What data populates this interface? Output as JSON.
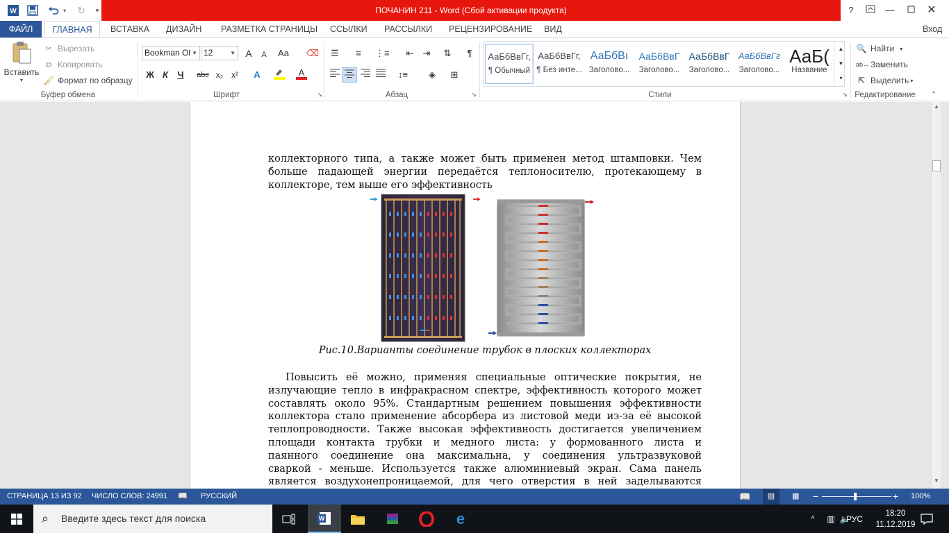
{
  "window": {
    "title": "ПОЧАНИН 211 -  Word (Сбой активации продукта)",
    "help": "?",
    "signin": "Вход"
  },
  "tabs": [
    "ФАЙЛ",
    "ГЛАВНАЯ",
    "ВСТАВКА",
    "ДИЗАЙН",
    "РАЗМЕТКА СТРАНИЦЫ",
    "ССЫЛКИ",
    "РАССЫЛКИ",
    "РЕЦЕНЗИРОВАНИЕ",
    "ВИД"
  ],
  "active_tab": "ГЛАВНАЯ",
  "ribbon": {
    "clipboard": {
      "label": "Буфер обмена",
      "paste": "Вставить",
      "cut": "Вырезать",
      "copy": "Копировать",
      "format_painter": "Формат по образцу"
    },
    "font": {
      "label": "Шрифт",
      "font_name": "Bookman Ol",
      "font_size": "12",
      "bold": "Ж",
      "italic": "К",
      "underline": "Ч",
      "strikethrough": "abc",
      "subscript": "x₂",
      "superscript": "x²",
      "grow": "A",
      "shrink": "A",
      "case": "Aa"
    },
    "paragraph": {
      "label": "Абзац"
    },
    "styles": {
      "label": "Стили",
      "items": [
        {
          "sample": "АаБбВвГг,",
          "name": "¶ Обычный"
        },
        {
          "sample": "АаБбВвГг,",
          "name": "¶ Без инте..."
        },
        {
          "sample": "АаБбВı",
          "name": "Заголово..."
        },
        {
          "sample": "АаБбВвГ",
          "name": "Заголово..."
        },
        {
          "sample": "АаБбВвГ",
          "name": "Заголово..."
        },
        {
          "sample": "АаБбВвГг",
          "name": "Заголово..."
        },
        {
          "sample": "АаБ(",
          "name": "Название"
        }
      ]
    },
    "editing": {
      "label": "Редактирование",
      "find": "Найти",
      "replace": "Заменить",
      "select": "Выделить"
    }
  },
  "document": {
    "para1_lines": [
      "коллекторного типа, а также может быть применен метод штамповки. Чем",
      "больше падающей энергии передаётся теплоносителю, протекающему в",
      "коллекторе, тем выше его эффективность"
    ],
    "caption": "Рис.10.Варианты соединение трубок в плоских коллекторах",
    "para2_lines": [
      "Повысить её можно, применяя специальные оптические покрытия, не",
      "излучающие тепло в инфракрасном спектре, эффективность которого может",
      "составлять около 95%. Стандартным решением повышения эффективности",
      "коллектора стало применение абсорбера из листовой меди из-за её высокой",
      "теплопроводности. Также высокая эффективность достигается увеличением",
      "площади контакта трубки и медного листа: у формованного листа и",
      "паянного соединение она максимальна, у соединения ультразвуковой",
      "сваркой - меньше. Используется также алюминиевый экран. Сама панель",
      "является воздухонепроницаемой, для чего отверстия в ней заделываются"
    ]
  },
  "status": {
    "page": "СТРАНИЦА 13 ИЗ 92",
    "words": "ЧИСЛО СЛОВ: 24991",
    "language": "РУССКИЙ",
    "zoom": "100%",
    "zoom_minus": "−",
    "zoom_plus": "+"
  },
  "taskbar": {
    "search_placeholder": "Введите здесь текст для поиска",
    "lang": "РУС",
    "time": "18:20",
    "date": "11.12.2019"
  },
  "colors": {
    "word_blue": "#2b579a",
    "title_red": "#e8170d",
    "taskbar": "#101418"
  }
}
